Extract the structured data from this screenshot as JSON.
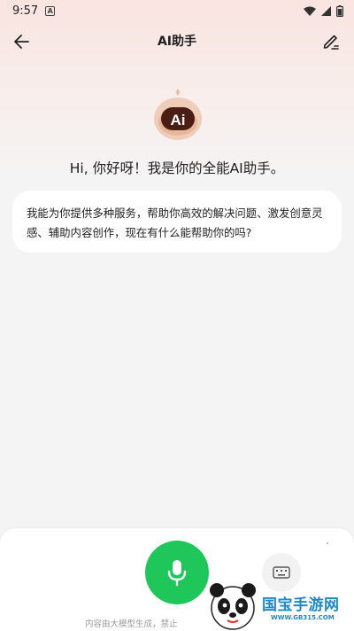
{
  "status_bar": {
    "time": "9:57",
    "notification_badge": "A",
    "icons": [
      "wifi-icon",
      "signal-icon",
      "battery-icon"
    ]
  },
  "header": {
    "title": "AI助手",
    "back_icon": "arrow-left-icon",
    "edit_icon": "edit-icon"
  },
  "mascot": {
    "label": "Ai"
  },
  "greeting": "Hi, 你好呀！我是你的全能AI助手。",
  "message": {
    "line1": "我能为你提供多种服务，帮助你高效的解决问题、激发创意灵",
    "line2": "感、辅助内容创作，现在有什么能帮助你的吗?"
  },
  "bottom": {
    "mic_icon": "microphone-icon",
    "keyboard_icon": "keyboard-icon",
    "disclaimer": "内容由大模型生成，禁止"
  },
  "watermark": {
    "brand": "国宝手游网",
    "url": "WWW.GB315.COM"
  },
  "colors": {
    "accent_green": "#1fc65a",
    "header_gradient": "#f9e4e0",
    "watermark_blue": "#1e88c8"
  }
}
